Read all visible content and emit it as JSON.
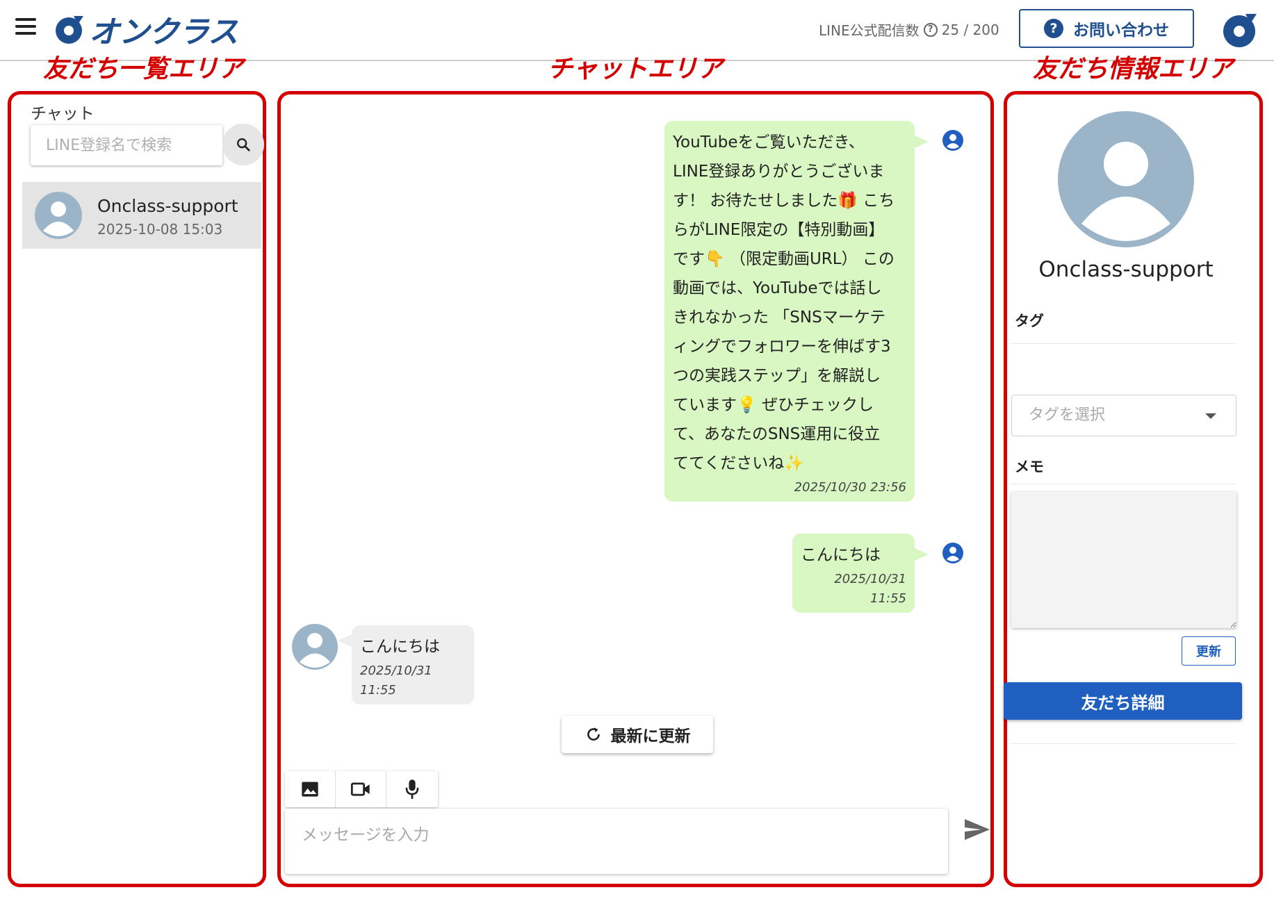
{
  "header": {
    "logo_text": "オンクラス",
    "line_count_label": "LINE公式配信数",
    "line_count_value": "25 / 200",
    "contact_button": "お問い合わせ"
  },
  "area_labels": {
    "friends_list": "友だち一覧エリア",
    "chat": "チャットエリア",
    "friend_info": "友だち情報エリア"
  },
  "friends_list": {
    "title": "チャット",
    "search_placeholder": "LINE登録名で検索",
    "items": [
      {
        "name": "Onclass-support",
        "date": "2025-10-08 15:03"
      }
    ]
  },
  "chat": {
    "messages": [
      {
        "direction": "sent",
        "lines": [
          "YouTubeをご覧いただき、",
          "LINE登録ありがとうございま",
          "す！ お待たせしました🎁 こち",
          "らがLINE限定の【特別動画】",
          "です👇 （限定動画URL） この",
          "動画では、YouTubeでは話し",
          "きれなかった 「SNSマーケテ",
          "ィングでフォロワーを伸ばす3",
          "つの実践ステップ」を解説し",
          "ています💡 ぜひチェックし",
          "て、あなたのSNS運用に役立",
          "ててくださいね✨"
        ],
        "time": "2025/10/30 23:56"
      },
      {
        "direction": "sent",
        "text": "こんにちは",
        "time": "2025/10/31 11:55"
      },
      {
        "direction": "received",
        "text": "こんにちは",
        "time": "2025/10/31 11:55"
      }
    ],
    "refresh_button": "最新に更新",
    "input_placeholder": "メッセージを入力"
  },
  "friend_info": {
    "name": "Onclass-support",
    "tag_label": "タグ",
    "tag_select_placeholder": "タグを選択",
    "memo_label": "メモ",
    "update_button": "更新",
    "detail_button": "友だち詳細"
  },
  "colors": {
    "brand": "#1f4f8f",
    "annotation_red": "#d40000",
    "sent_bubble": "#d8f7c2",
    "received_bubble": "#eeeeee",
    "primary_button": "#1f5fbf",
    "avatar_gray": "#9bb4c7"
  },
  "icons": [
    "hamburger-icon",
    "logo-icon",
    "help-icon",
    "question-icon",
    "search-icon",
    "user-icon",
    "image-icon",
    "video-icon",
    "mic-icon",
    "send-icon",
    "refresh-icon",
    "caret-down-icon"
  ]
}
